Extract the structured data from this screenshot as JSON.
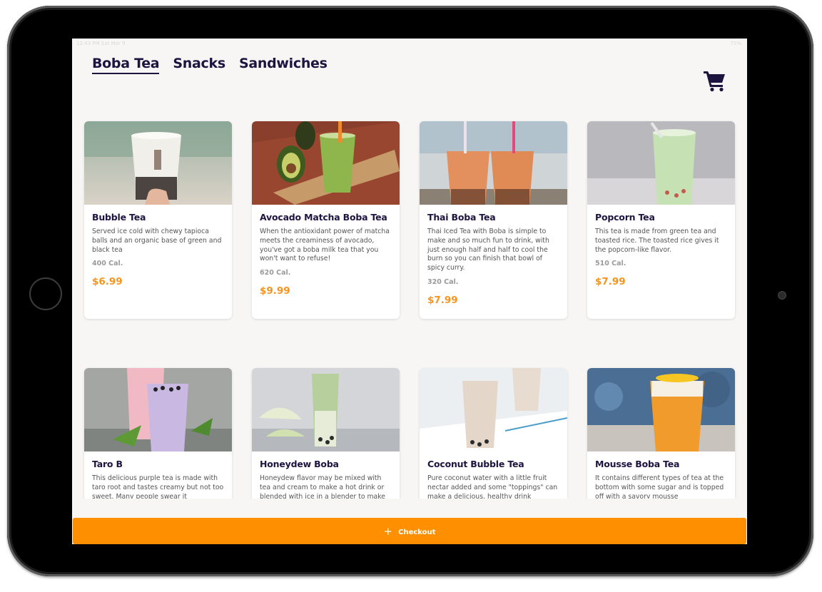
{
  "status_bar": {
    "time": "12:43 PM  Sat Mar 9",
    "battery": "75%"
  },
  "tabs": [
    {
      "label": "Boba Tea",
      "active": true
    },
    {
      "label": "Snacks",
      "active": false
    },
    {
      "label": "Sandwiches",
      "active": false
    }
  ],
  "cart": {
    "icon": "shopping-cart-icon"
  },
  "products": [
    {
      "name": "Bubble Tea",
      "description": "Served ice cold with chewy tapioca balls and an organic base of green and black tea",
      "calories": "400 Cal.",
      "price": "$6.99"
    },
    {
      "name": "Avocado Matcha Boba Tea",
      "description": "When the antioxidant power of matcha meets the creaminess of avocado, you've got a boba milk tea that you won't want to refuse!",
      "calories": "620 Cal.",
      "price": "$9.99"
    },
    {
      "name": "Thai Boba Tea",
      "description": "Thai Iced Tea with Boba is simple to make and so much fun to drink, with just enough half and half to cool the burn so you can finish that bowl of spicy curry.",
      "calories": "320 Cal.",
      "price": "$7.99"
    },
    {
      "name": "Popcorn Tea",
      "description": "This tea is made from green tea and toasted rice. The toasted rice gives it the popcorn-like flavor.",
      "calories": "510 Cal.",
      "price": "$7.99"
    },
    {
      "name": "Taro B",
      "description": "This delicious purple tea is made with taro root and tastes creamy but not too sweet. Many people swear it",
      "calories": "",
      "price": ""
    },
    {
      "name": "Honeydew Boba",
      "description": "Honeydew flavor may be mixed with tea and cream to make a hot drink or blended with ice in a blender to make",
      "calories": "",
      "price": ""
    },
    {
      "name": "Coconut Bubble Tea",
      "description": "Pure coconut water with a little fruit nectar added and some \"toppings\" can make a delicious, healthy drink",
      "calories": "",
      "price": ""
    },
    {
      "name": "Mousse Boba Tea",
      "description": "It contains different types of tea at the bottom with some sugar and is topped off with a savory mousse",
      "calories": "",
      "price": ""
    }
  ],
  "checkout": {
    "label": "Checkout",
    "icon": "plus-icon"
  },
  "colors": {
    "accent": "#fd8f00",
    "price": "#f7941d",
    "title": "#1e1440",
    "background": "#f7f6f4"
  }
}
